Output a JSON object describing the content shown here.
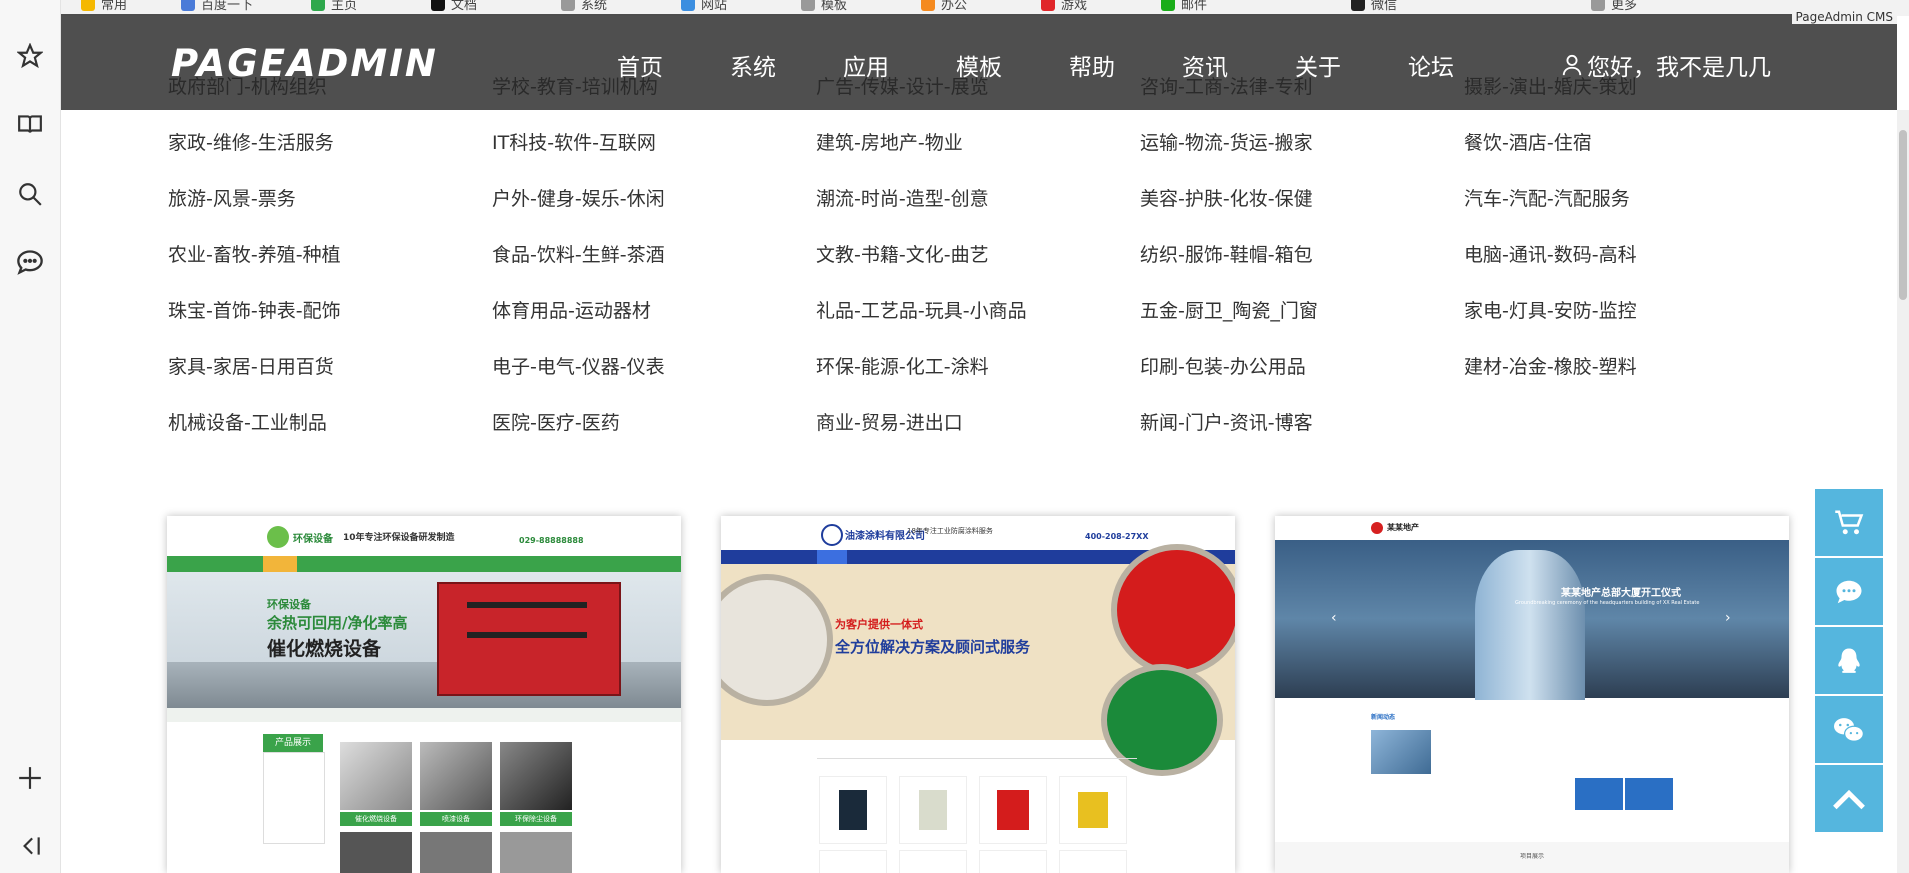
{
  "browser": {
    "bookmarks": [
      "常用",
      "百度一下",
      "主页",
      "文档",
      "系统",
      "网站",
      "模板",
      "办公",
      "游戏",
      "邮件",
      "微信",
      "更多"
    ],
    "sidebar_icons": [
      "star-icon",
      "reading-list-icon",
      "search-icon",
      "chat-icon",
      "add-icon",
      "collapse-icon"
    ]
  },
  "header": {
    "logo": "PAGEADMIN",
    "nav": [
      "首页",
      "系统",
      "应用",
      "模板",
      "帮助",
      "资讯",
      "关于",
      "论坛"
    ],
    "user_greeting": "您好，我不是几几",
    "cms_tag": "PageAdmin CMS"
  },
  "categories": [
    [
      "政府部门-机构组织",
      "学校-教育-培训机构",
      "广告-传媒-设计-展览",
      "咨询-工商-法律-专利",
      "摄影-演出-婚庆-策划"
    ],
    [
      "家政-维修-生活服务",
      "IT科技-软件-互联网",
      "建筑-房地产-物业",
      "运输-物流-货运-搬家",
      "餐饮-酒店-住宿"
    ],
    [
      "旅游-风景-票务",
      "户外-健身-娱乐-休闲",
      "潮流-时尚-造型-创意",
      "美容-护肤-化妆-保健",
      "汽车-汽配-汽配服务"
    ],
    [
      "农业-畜牧-养殖-种植",
      "食品-饮料-生鲜-茶酒",
      "文教-书籍-文化-曲艺",
      "纺织-服饰-鞋帽-箱包",
      "电脑-通讯-数码-高科"
    ],
    [
      "珠宝-首饰-钟表-配饰",
      "体育用品-运动器材",
      "礼品-工艺品-玩具-小商品",
      "五金-厨卫_陶瓷_门窗",
      "家电-灯具-安防-监控"
    ],
    [
      "家具-家居-日用百货",
      "电子-电气-仪器-仪表",
      "环保-能源-化工-涂料",
      "印刷-包装-办公用品",
      "建材-冶金-橡胶-塑料"
    ],
    [
      "机械设备-工业制品",
      "医院-医疗-医药",
      "商业-贸易-进出口",
      "新闻-门户-资讯-博客",
      ""
    ]
  ],
  "thumbnails": [
    {
      "brand": "环保设备",
      "slogan": "10年专注环保设备研发制造",
      "phone": "029-88888888",
      "hero_small": "环保设备",
      "hero_line1": "余热可回用/净化率高",
      "hero_line2": "催化燃烧设备",
      "side_title": "产品展示",
      "btns": [
        "催化燃烧设备",
        "喷漆设备",
        "环保除尘设备"
      ]
    },
    {
      "brand": "油漆涂料有限公司",
      "slogan": "18年专注工业防腐涂料服务",
      "phone": "400-208-27XX",
      "hero_line1": "为客户提供一体式",
      "hero_line2": "全方位解决方案及顾问式服务"
    },
    {
      "brand": "某某地产",
      "hero_line1": "某某地产总部大厦开工仪式",
      "hero_line2": "Groundbreaking ceremony of the headquarters building of XX Real Estate",
      "section_title": "新闻动态",
      "bottom_title": "项目展示"
    }
  ],
  "float_bar": [
    "cart-icon",
    "message-icon",
    "qq-icon",
    "wechat-icon",
    "back-to-top-icon"
  ],
  "colors": {
    "header_bg": "#282828",
    "float_bg": "#55b6de",
    "env_green": "#3aa34a",
    "paint_blue": "#1f3d9c",
    "estate_blue": "#2a6fc4"
  }
}
